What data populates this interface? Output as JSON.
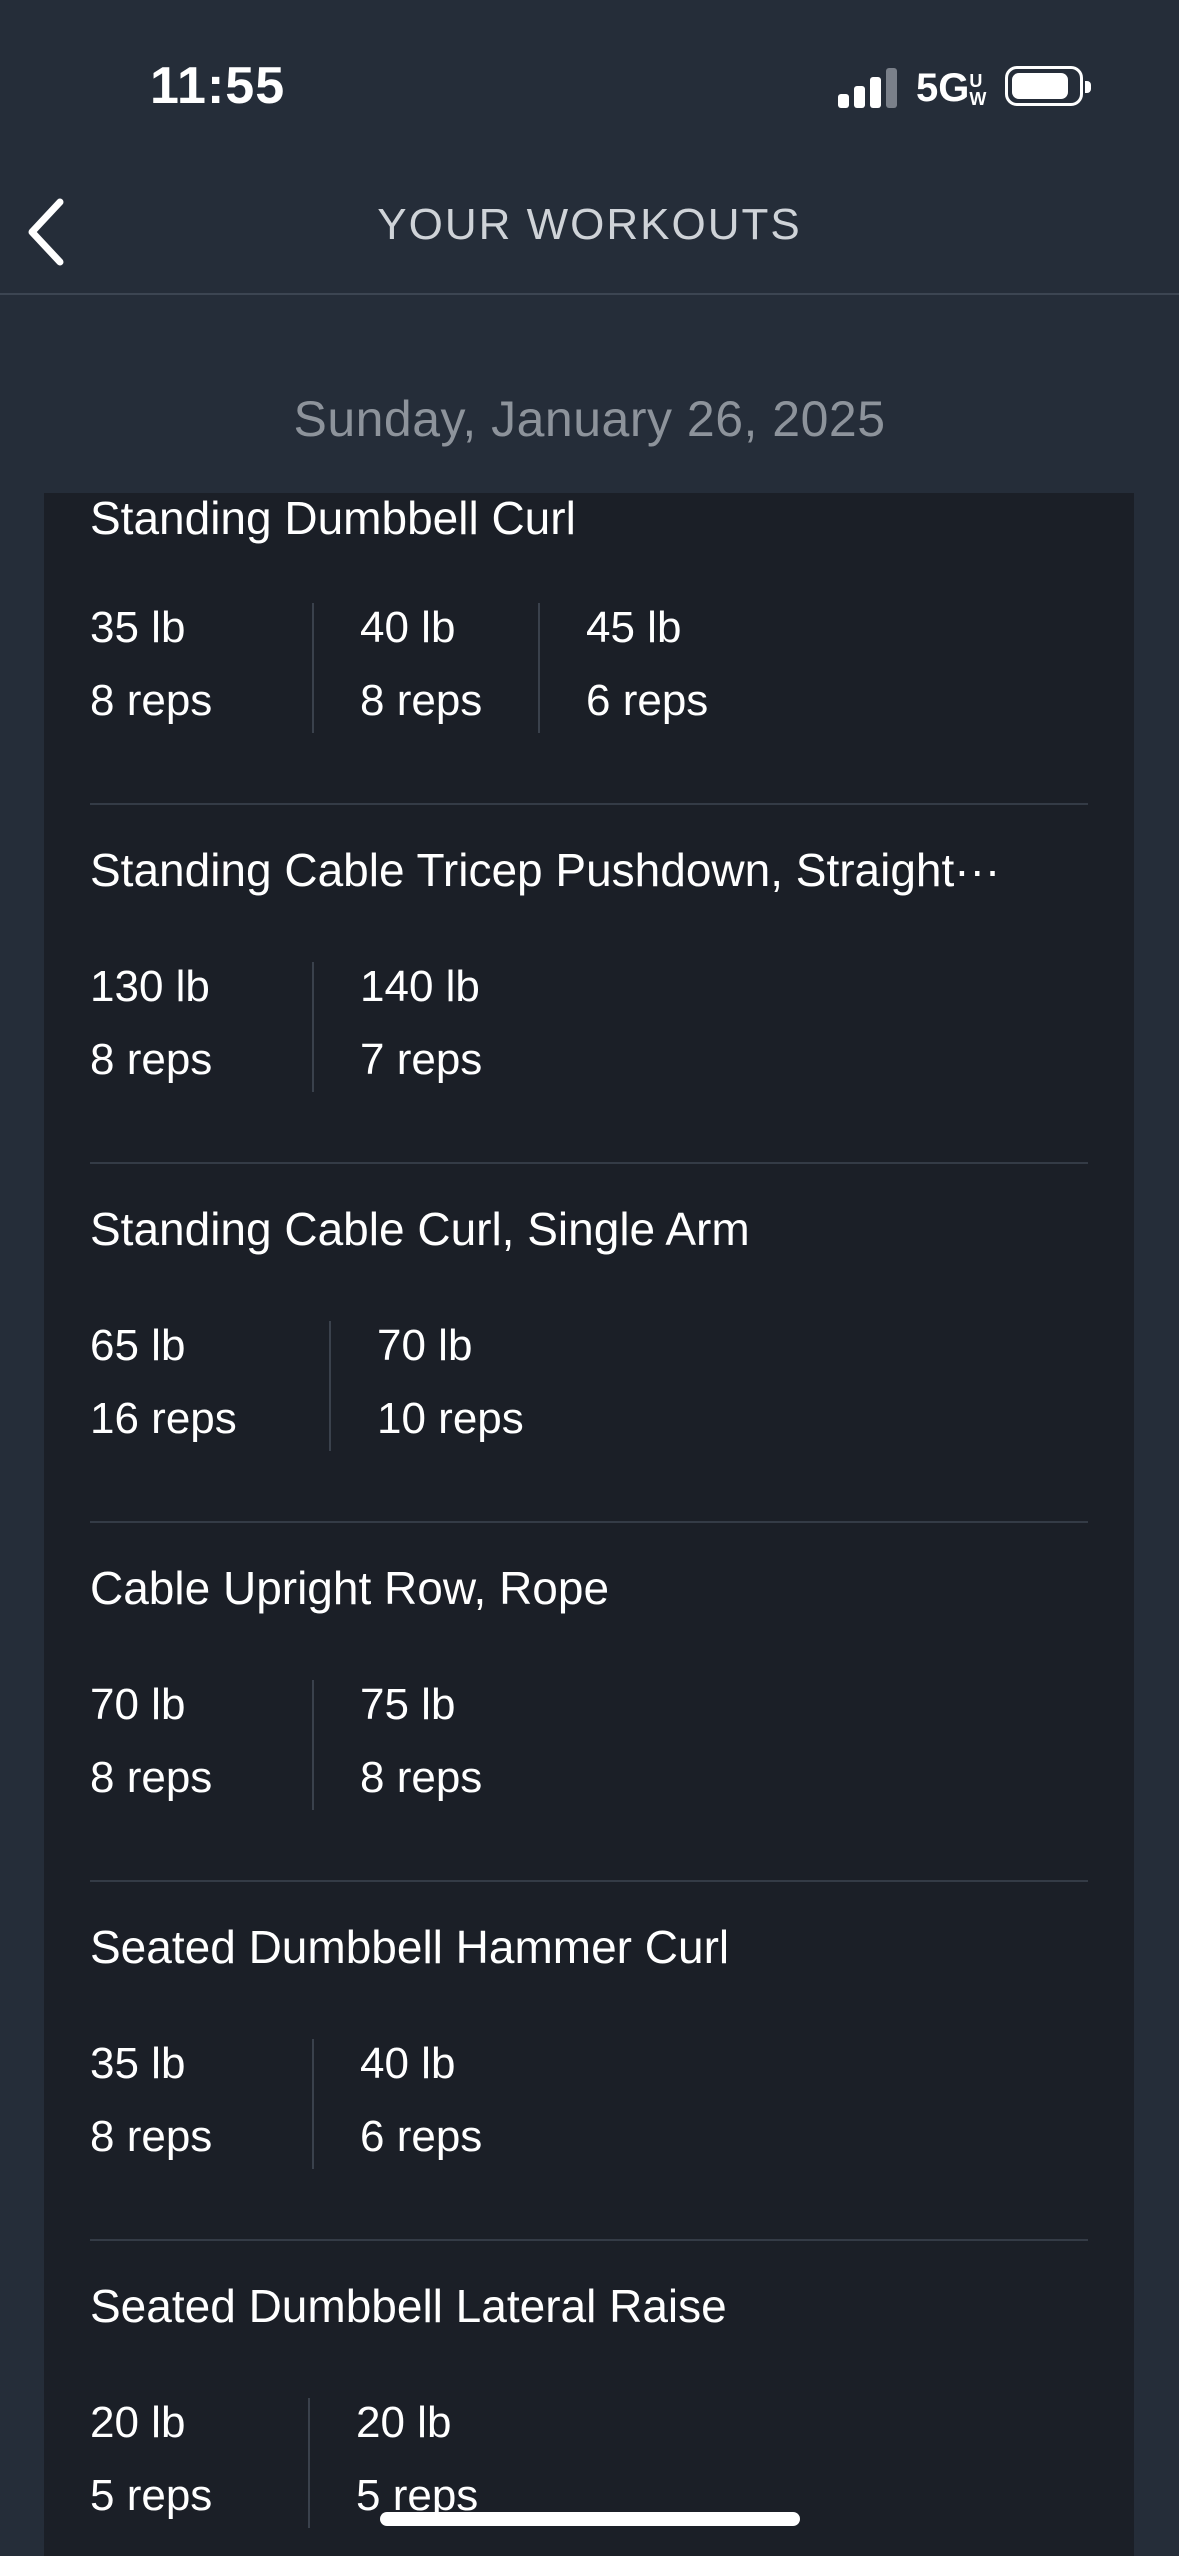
{
  "status_bar": {
    "time": "11:55",
    "network": "5G",
    "network_sup": "UW"
  },
  "nav": {
    "title": "YOUR WORKOUTS"
  },
  "date": "Sunday, January 26, 2025",
  "exercises": [
    {
      "name": "Standing Dumbbell Curl",
      "sets": [
        {
          "weight": "35 lb",
          "reps": "8 reps"
        },
        {
          "weight": "40 lb",
          "reps": "8 reps"
        },
        {
          "weight": "45 lb",
          "reps": "6 reps"
        }
      ]
    },
    {
      "name": "Standing Cable Tricep Pushdown, Straight···",
      "sets": [
        {
          "weight": "130 lb",
          "reps": "8 reps"
        },
        {
          "weight": "140 lb",
          "reps": "7 reps"
        }
      ]
    },
    {
      "name": "Standing Cable Curl, Single Arm",
      "sets": [
        {
          "weight": "65 lb",
          "reps": "16 reps"
        },
        {
          "weight": "70 lb",
          "reps": "10 reps"
        }
      ]
    },
    {
      "name": "Cable Upright Row, Rope",
      "sets": [
        {
          "weight": "70 lb",
          "reps": "8 reps"
        },
        {
          "weight": "75 lb",
          "reps": "8 reps"
        }
      ]
    },
    {
      "name": "Seated Dumbbell Hammer Curl",
      "sets": [
        {
          "weight": "35 lb",
          "reps": "8 reps"
        },
        {
          "weight": "40 lb",
          "reps": "6 reps"
        }
      ]
    },
    {
      "name": "Seated Dumbbell Lateral Raise",
      "sets": [
        {
          "weight": "20 lb",
          "reps": "5 reps"
        },
        {
          "weight": "20 lb",
          "reps": "5 reps"
        }
      ]
    }
  ]
}
